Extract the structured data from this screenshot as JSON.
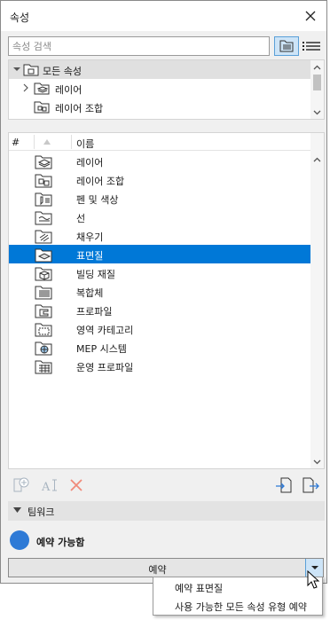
{
  "window": {
    "title": "속성"
  },
  "search": {
    "placeholder": "속성 검색"
  },
  "tree": {
    "items": [
      {
        "label": "모든 속성",
        "icon": "folder-all-icon",
        "expanded": true,
        "selected": true
      },
      {
        "label": "레이어",
        "icon": "layer-icon",
        "expanded": false
      },
      {
        "label": "레이어 조합",
        "icon": "layer-combination-icon"
      }
    ]
  },
  "list": {
    "header": {
      "hash": "#",
      "name": "이름"
    },
    "items": [
      {
        "label": "레이어",
        "icon": "layer-icon"
      },
      {
        "label": "레이어 조합",
        "icon": "layer-combination-icon"
      },
      {
        "label": "펜 및 색상",
        "icon": "pen-color-icon"
      },
      {
        "label": "선",
        "icon": "line-type-icon"
      },
      {
        "label": "채우기",
        "icon": "fill-icon"
      },
      {
        "label": "표면질",
        "icon": "surface-icon",
        "selected": true
      },
      {
        "label": "빌딩 재질",
        "icon": "building-material-icon"
      },
      {
        "label": "복합체",
        "icon": "composite-icon"
      },
      {
        "label": "프로파일",
        "icon": "profile-icon"
      },
      {
        "label": "영역 카테고리",
        "icon": "zone-category-icon"
      },
      {
        "label": "MEP 시스템",
        "icon": "mep-system-icon"
      },
      {
        "label": "운영 프로파일",
        "icon": "operation-profile-icon"
      }
    ]
  },
  "teamwork": {
    "title": "팀워크",
    "status": "예약 가능함",
    "status_color": "#2e7ad6",
    "reserve_label": "예약",
    "dropdown": [
      "예약 표면질",
      "사용 가능한 모든 속성 유형 예약"
    ]
  },
  "colors": {
    "selection": "#0078d7",
    "accent": "#5aa0d8"
  }
}
